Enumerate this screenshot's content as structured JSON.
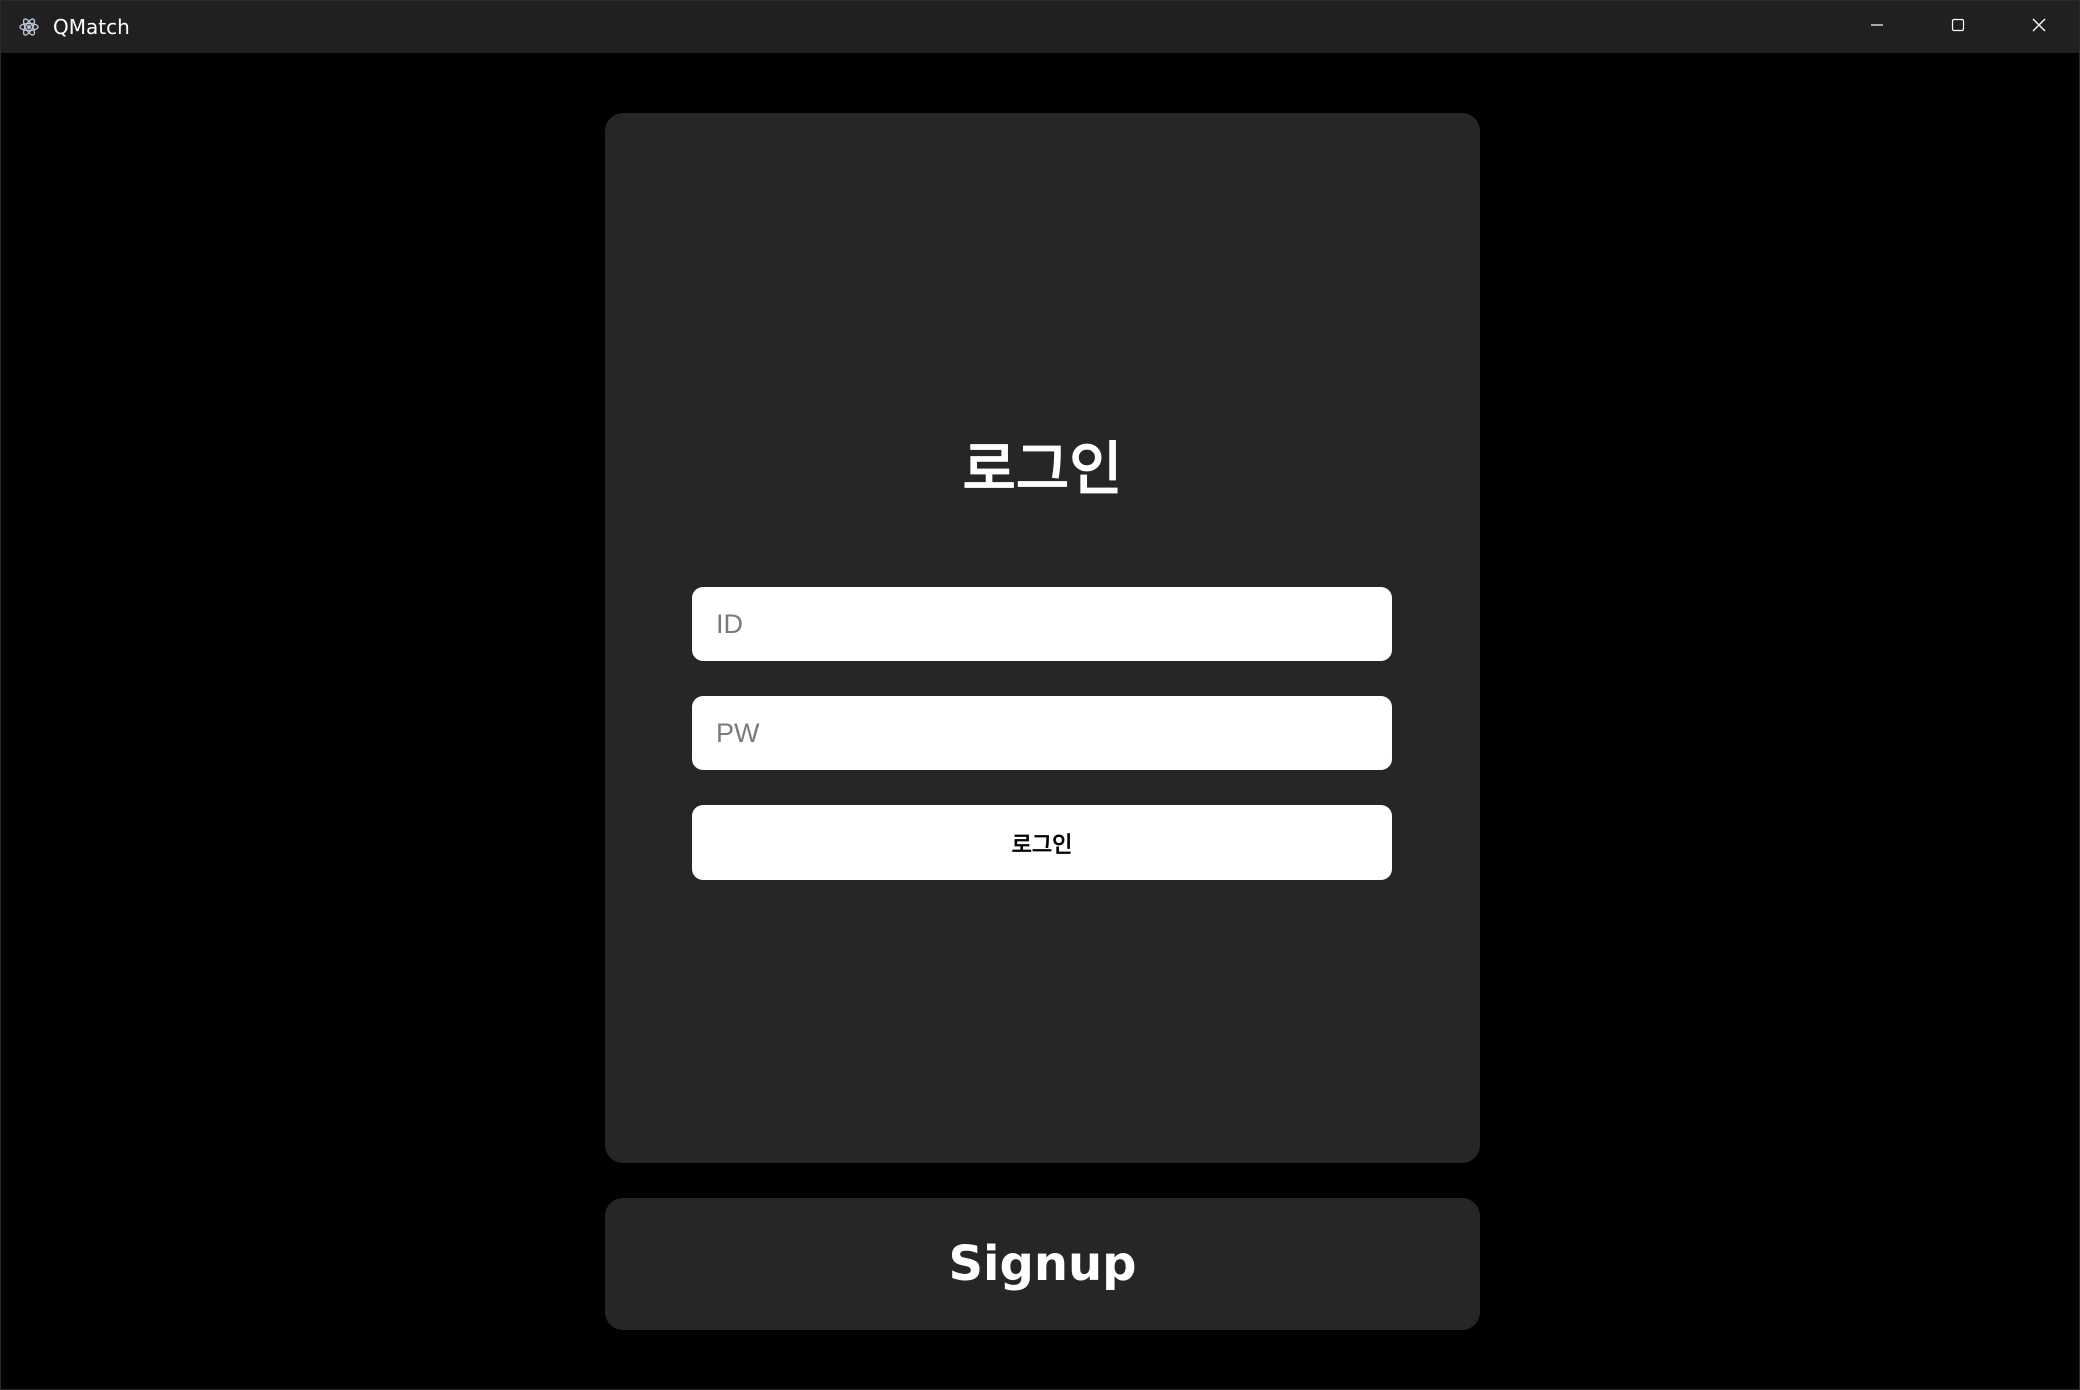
{
  "window": {
    "title": "QMatch",
    "icon": "electron-atom-icon",
    "controls": [
      "minimize-icon",
      "maximize-icon",
      "close-icon"
    ]
  },
  "login": {
    "heading": "로그인",
    "id_placeholder": "ID",
    "pw_placeholder": "PW",
    "submit_label": "로그인"
  },
  "signup": {
    "label": "Signup"
  },
  "colors": {
    "background": "#000000",
    "titlebar": "#202020",
    "card": "#262626",
    "field": "#ffffff",
    "text_light": "#ffffff"
  }
}
